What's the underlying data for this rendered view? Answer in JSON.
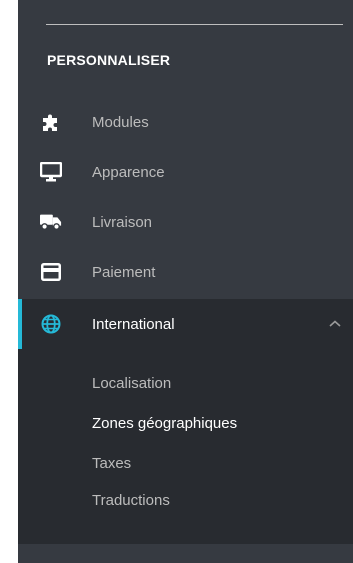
{
  "section": {
    "title": "PERSONNALISER"
  },
  "menu": {
    "items": [
      {
        "label": "Modules",
        "icon": "puzzle-icon"
      },
      {
        "label": "Apparence",
        "icon": "monitor-icon"
      },
      {
        "label": "Livraison",
        "icon": "truck-icon"
      },
      {
        "label": "Paiement",
        "icon": "credit-card-icon"
      },
      {
        "label": "International",
        "icon": "globe-icon",
        "active": true,
        "expanded": true
      }
    ]
  },
  "submenu": {
    "items": [
      {
        "label": "Localisation"
      },
      {
        "label": "Zones géographiques",
        "current": true
      },
      {
        "label": "Taxes"
      },
      {
        "label": "Traductions"
      }
    ]
  },
  "colors": {
    "sidebar_bg": "#363a41",
    "active_bg": "#282b30",
    "accent": "#25b9d7",
    "text_muted": "#bcbcbc",
    "text_active": "#ffffff"
  }
}
